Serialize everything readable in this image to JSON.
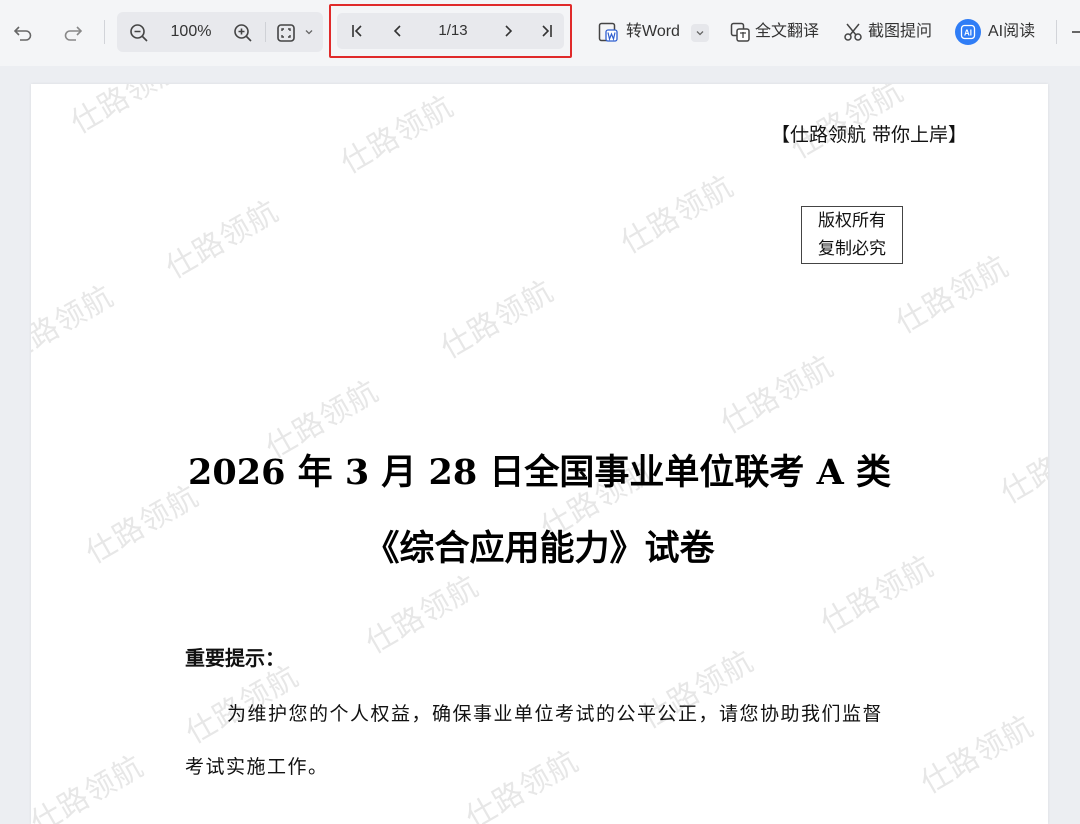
{
  "toolbar": {
    "zoom_level": "100%",
    "page_indicator": "1/13",
    "convert_word_label": "转Word",
    "translate_label": "全文翻译",
    "screenshot_ask_label": "截图提问",
    "ai_read_label": "AI阅读",
    "icons": [
      "undo-icon",
      "redo-icon",
      "zoom-out-icon",
      "zoom-in-icon",
      "fit-page-icon",
      "chevron-down-icon",
      "first-page-icon",
      "prev-page-icon",
      "next-page-icon",
      "last-page-icon",
      "word-icon",
      "translate-icon",
      "scissors-icon",
      "ai-icon"
    ],
    "accent_color": "#e02a2a",
    "ai_color": "#2f7df6"
  },
  "document": {
    "slogan": "【仕路领航  带你上岸】",
    "copyright_line1": "版权所有",
    "copyright_line2": "复制必究",
    "title_line1": "2026 年 3 月 28 日全国事业单位联考 A 类",
    "title_line2": "《综合应用能力》试卷",
    "notice_heading": "重要提示：",
    "notice_line1": "为维护您的个人权益，确保事业单位考试的公平公正，请您协助我们监督",
    "notice_line2": "考试实施工作。",
    "watermark_text": "仕路领航",
    "watermark_partial": "仕路"
  }
}
